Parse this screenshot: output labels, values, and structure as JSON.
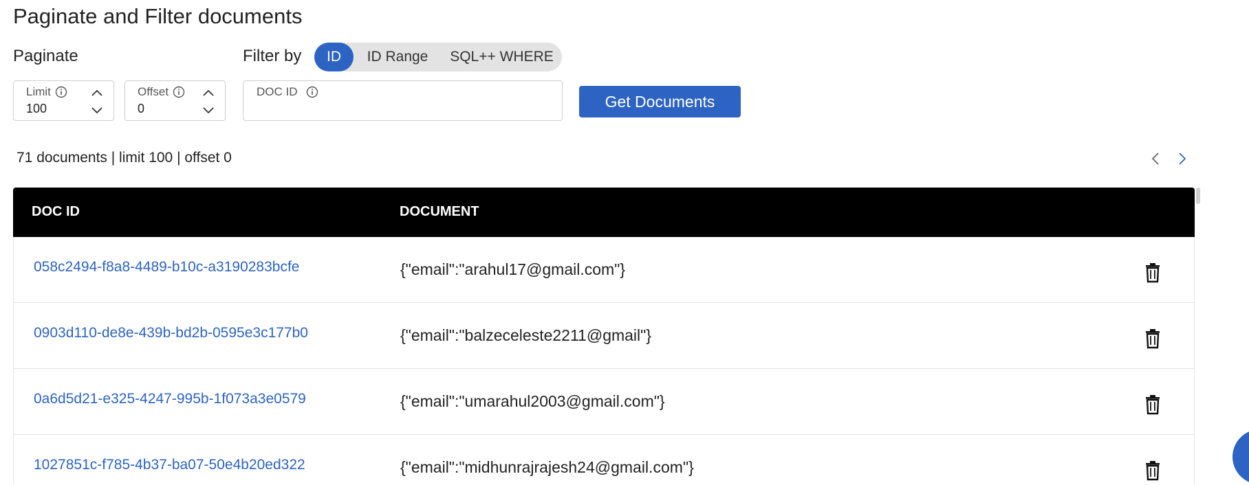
{
  "page": {
    "title": "Paginate and Filter documents"
  },
  "paginate": {
    "label": "Paginate",
    "limit": {
      "label": "Limit",
      "value": "100"
    },
    "offset": {
      "label": "Offset",
      "value": "0"
    }
  },
  "filter": {
    "label": "Filter by",
    "options": [
      "ID",
      "ID Range",
      "SQL++ WHERE"
    ],
    "selected": "ID",
    "docid_field": {
      "label": "DOC ID",
      "value": ""
    }
  },
  "actions": {
    "get_documents_label": "Get Documents"
  },
  "results": {
    "summary": "71 documents | limit 100 | offset 0",
    "columns": [
      "DOC ID",
      "DOCUMENT"
    ],
    "rows": [
      {
        "doc_id": "058c2494-f8a8-4489-b10c-a3190283bcfe",
        "document": "{\"email\":\"arahul17@gmail.com\"}"
      },
      {
        "doc_id": "0903d110-de8e-439b-bd2b-0595e3c177b0",
        "document": "{\"email\":\"balzeceleste2211@gmail\"}"
      },
      {
        "doc_id": "0a6d5d21-e325-4247-995b-1f073a3e0579",
        "document": "{\"email\":\"umarahul2003@gmail.com\"}"
      },
      {
        "doc_id": "1027851c-f785-4b37-ba07-50e4b20ed322",
        "document": "{\"email\":\"midhunrajrajesh24@gmail.com\"}"
      }
    ]
  },
  "icons": {
    "info": "info-icon",
    "stepper_up": "chevron-up-icon",
    "stepper_down": "chevron-down-icon",
    "prev": "chevron-left-icon",
    "next": "chevron-right-icon",
    "delete": "trash-icon"
  },
  "colors": {
    "accent": "#2d63c2",
    "header_bg": "#000000",
    "toggle_bg": "#e3e3e3"
  }
}
